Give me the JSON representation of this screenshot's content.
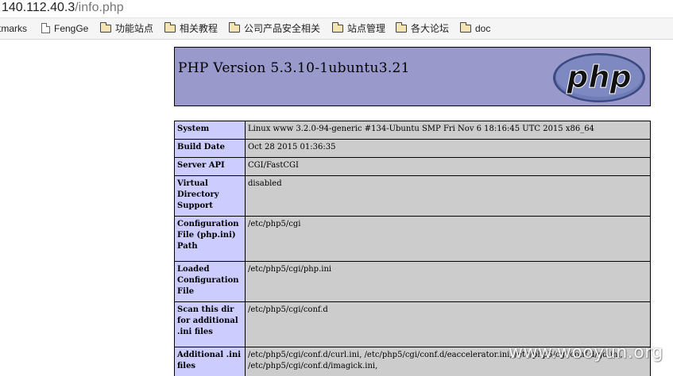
{
  "browser": {
    "url_host": "140.112.40.3",
    "url_path": "/info.php",
    "bookmarks": [
      {
        "label": "tmarks",
        "icon": "none"
      },
      {
        "label": "FengGe",
        "icon": "page-icon"
      },
      {
        "label": "功能站点",
        "icon": "folder-icon"
      },
      {
        "label": "相关教程",
        "icon": "folder-icon"
      },
      {
        "label": "公司产品安全相关",
        "icon": "folder-icon"
      },
      {
        "label": "站点管理",
        "icon": "folder-icon"
      },
      {
        "label": "各大论坛",
        "icon": "folder-icon"
      },
      {
        "label": "doc",
        "icon": "folder-icon"
      }
    ]
  },
  "phpinfo": {
    "title": "PHP Version 5.3.10-1ubuntu3.21",
    "logo_text": "php",
    "rows": [
      {
        "key": "System",
        "value": "Linux www 3.2.0-94-generic #134-Ubuntu SMP Fri Nov 6 18:16:45 UTC 2015 x86_64"
      },
      {
        "key": "Build Date",
        "value": "Oct 28 2015 01:36:35"
      },
      {
        "key": "Server API",
        "value": "CGI/FastCGI"
      },
      {
        "key": "Virtual Directory Support",
        "value": "disabled"
      },
      {
        "key": "Configuration File (php.ini) Path",
        "value": "/etc/php5/cgi"
      },
      {
        "key": "Loaded Configuration File",
        "value": "/etc/php5/cgi/php.ini"
      },
      {
        "key": "Scan this dir for additional .ini files",
        "value": "/etc/php5/cgi/conf.d"
      },
      {
        "key": "Additional .ini files",
        "value": "/etc/php5/cgi/conf.d/curl.ini, /etc/php5/cgi/conf.d/eaccelerator.ini, /etc/php5/cgi/conf.d/gd.ini, /etc/php5/cgi/conf.d/imagick.ini,"
      }
    ]
  },
  "watermark": "www.wooyun.org",
  "colors": {
    "header_bg": "#9999cc",
    "key_bg": "#ccccff",
    "value_bg": "#cccccc"
  }
}
